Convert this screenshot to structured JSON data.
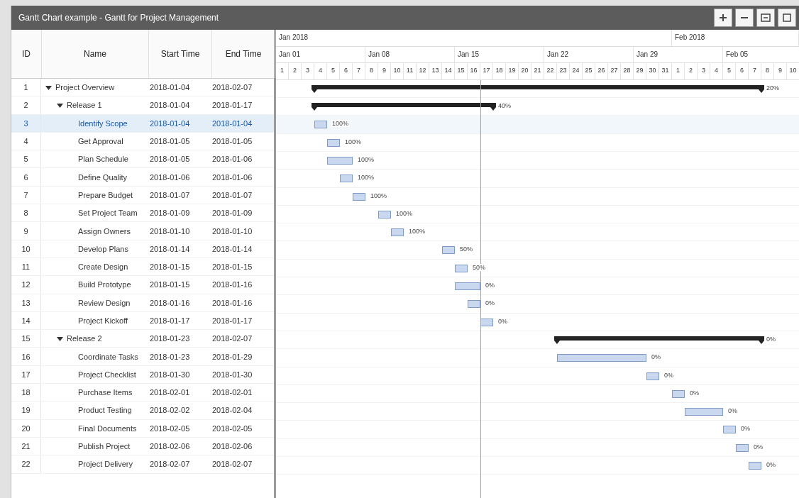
{
  "window": {
    "title": "Gantt Chart example - Gantt for Project Management"
  },
  "columns": [
    {
      "label": "ID"
    },
    {
      "label": "Name"
    },
    {
      "label": "Start Time"
    },
    {
      "label": "End Time"
    }
  ],
  "timeline": {
    "months": [
      "Jan 2018",
      "Feb 2018"
    ],
    "weeks": [
      "Jan 01",
      "Jan 08",
      "Jan 15",
      "Jan 22",
      "Jan 29",
      "Feb 05"
    ],
    "days": [
      {
        "label": "1",
        "today": false
      },
      {
        "label": "2",
        "today": false
      },
      {
        "label": "3",
        "today": false
      },
      {
        "label": "4",
        "today": false
      },
      {
        "label": "5",
        "today": false
      },
      {
        "label": "6",
        "today": false
      },
      {
        "label": "7",
        "today": false
      },
      {
        "label": "8",
        "today": false
      },
      {
        "label": "9",
        "today": false
      },
      {
        "label": "10",
        "today": false
      },
      {
        "label": "11",
        "today": false
      },
      {
        "label": "12",
        "today": false
      },
      {
        "label": "13",
        "today": false
      },
      {
        "label": "14",
        "today": false
      },
      {
        "label": "15",
        "today": false
      },
      {
        "label": "16",
        "today": false
      },
      {
        "label": "17",
        "today": true
      },
      {
        "label": "18",
        "today": false
      },
      {
        "label": "19",
        "today": false
      },
      {
        "label": "20",
        "today": false
      },
      {
        "label": "21",
        "today": false
      },
      {
        "label": "22",
        "today": false
      },
      {
        "label": "23",
        "today": false
      },
      {
        "label": "24",
        "today": false
      },
      {
        "label": "25",
        "today": false
      },
      {
        "label": "26",
        "today": false
      },
      {
        "label": "27",
        "today": false
      },
      {
        "label": "28",
        "today": false
      },
      {
        "label": "29",
        "today": false
      },
      {
        "label": "30",
        "today": false
      },
      {
        "label": "31",
        "today": false
      },
      {
        "label": "1",
        "today": false
      },
      {
        "label": "2",
        "today": false
      },
      {
        "label": "3",
        "today": false
      },
      {
        "label": "4",
        "today": false
      },
      {
        "label": "5",
        "today": false
      },
      {
        "label": "6",
        "today": false
      },
      {
        "label": "7",
        "today": false
      },
      {
        "label": "8",
        "today": false
      },
      {
        "label": "9",
        "today": false
      },
      {
        "label": "10",
        "today": false
      }
    ]
  },
  "tasks": [
    {
      "id": "1",
      "name": "Project Overview",
      "start": "2018-01-04",
      "end": "2018-02-07",
      "progress": "20%",
      "expanded": true,
      "selected": false,
      "children": [
        {
          "id": "2",
          "name": "Release 1",
          "start": "2018-01-04",
          "end": "2018-01-17",
          "progress": "40%",
          "expanded": true,
          "selected": false,
          "children": [
            {
              "id": "3",
              "name": "Identify Scope",
              "start": "2018-01-04",
              "end": "2018-01-04",
              "progress": "100%",
              "selected": true
            },
            {
              "id": "4",
              "name": "Get Approval",
              "start": "2018-01-05",
              "end": "2018-01-05",
              "progress": "100%",
              "selected": false
            },
            {
              "id": "5",
              "name": "Plan Schedule",
              "start": "2018-01-05",
              "end": "2018-01-06",
              "progress": "100%",
              "selected": false
            },
            {
              "id": "6",
              "name": "Define Quality",
              "start": "2018-01-06",
              "end": "2018-01-06",
              "progress": "100%",
              "selected": false
            },
            {
              "id": "7",
              "name": "Prepare Budget",
              "start": "2018-01-07",
              "end": "2018-01-07",
              "progress": "100%",
              "selected": false
            },
            {
              "id": "8",
              "name": "Set Project Team",
              "start": "2018-01-09",
              "end": "2018-01-09",
              "progress": "100%",
              "selected": false
            },
            {
              "id": "9",
              "name": "Assign Owners",
              "start": "2018-01-10",
              "end": "2018-01-10",
              "progress": "100%",
              "selected": false
            },
            {
              "id": "10",
              "name": "Develop Plans",
              "start": "2018-01-14",
              "end": "2018-01-14",
              "progress": "50%",
              "selected": false
            },
            {
              "id": "11",
              "name": "Create Design",
              "start": "2018-01-15",
              "end": "2018-01-15",
              "progress": "50%",
              "selected": false
            },
            {
              "id": "12",
              "name": "Build Prototype",
              "start": "2018-01-15",
              "end": "2018-01-16",
              "progress": "0%",
              "selected": false
            },
            {
              "id": "13",
              "name": "Review Design",
              "start": "2018-01-16",
              "end": "2018-01-16",
              "progress": "0%",
              "selected": false
            },
            {
              "id": "14",
              "name": "Project Kickoff",
              "start": "2018-01-17",
              "end": "2018-01-17",
              "progress": "0%",
              "selected": false
            }
          ]
        },
        {
          "id": "15",
          "name": "Release 2",
          "start": "2018-01-23",
          "end": "2018-02-07",
          "progress": "0%",
          "expanded": true,
          "selected": false,
          "children": [
            {
              "id": "16",
              "name": "Coordinate Tasks",
              "start": "2018-01-23",
              "end": "2018-01-29",
              "progress": "0%",
              "selected": false
            },
            {
              "id": "17",
              "name": "Project Checklist",
              "start": "2018-01-30",
              "end": "2018-01-30",
              "progress": "0%",
              "selected": false
            },
            {
              "id": "18",
              "name": "Purchase Items",
              "start": "2018-02-01",
              "end": "2018-02-01",
              "progress": "0%",
              "selected": false
            },
            {
              "id": "19",
              "name": "Product Testing",
              "start": "2018-02-02",
              "end": "2018-02-04",
              "progress": "0%",
              "selected": false
            },
            {
              "id": "20",
              "name": "Final Documents",
              "start": "2018-02-05",
              "end": "2018-02-05",
              "progress": "0%",
              "selected": false
            },
            {
              "id": "21",
              "name": "Publish Project",
              "start": "2018-02-06",
              "end": "2018-02-06",
              "progress": "0%",
              "selected": false
            },
            {
              "id": "22",
              "name": "Project Delivery",
              "start": "2018-02-07",
              "end": "2018-02-07",
              "progress": "0%",
              "selected": false
            }
          ]
        }
      ]
    }
  ]
}
